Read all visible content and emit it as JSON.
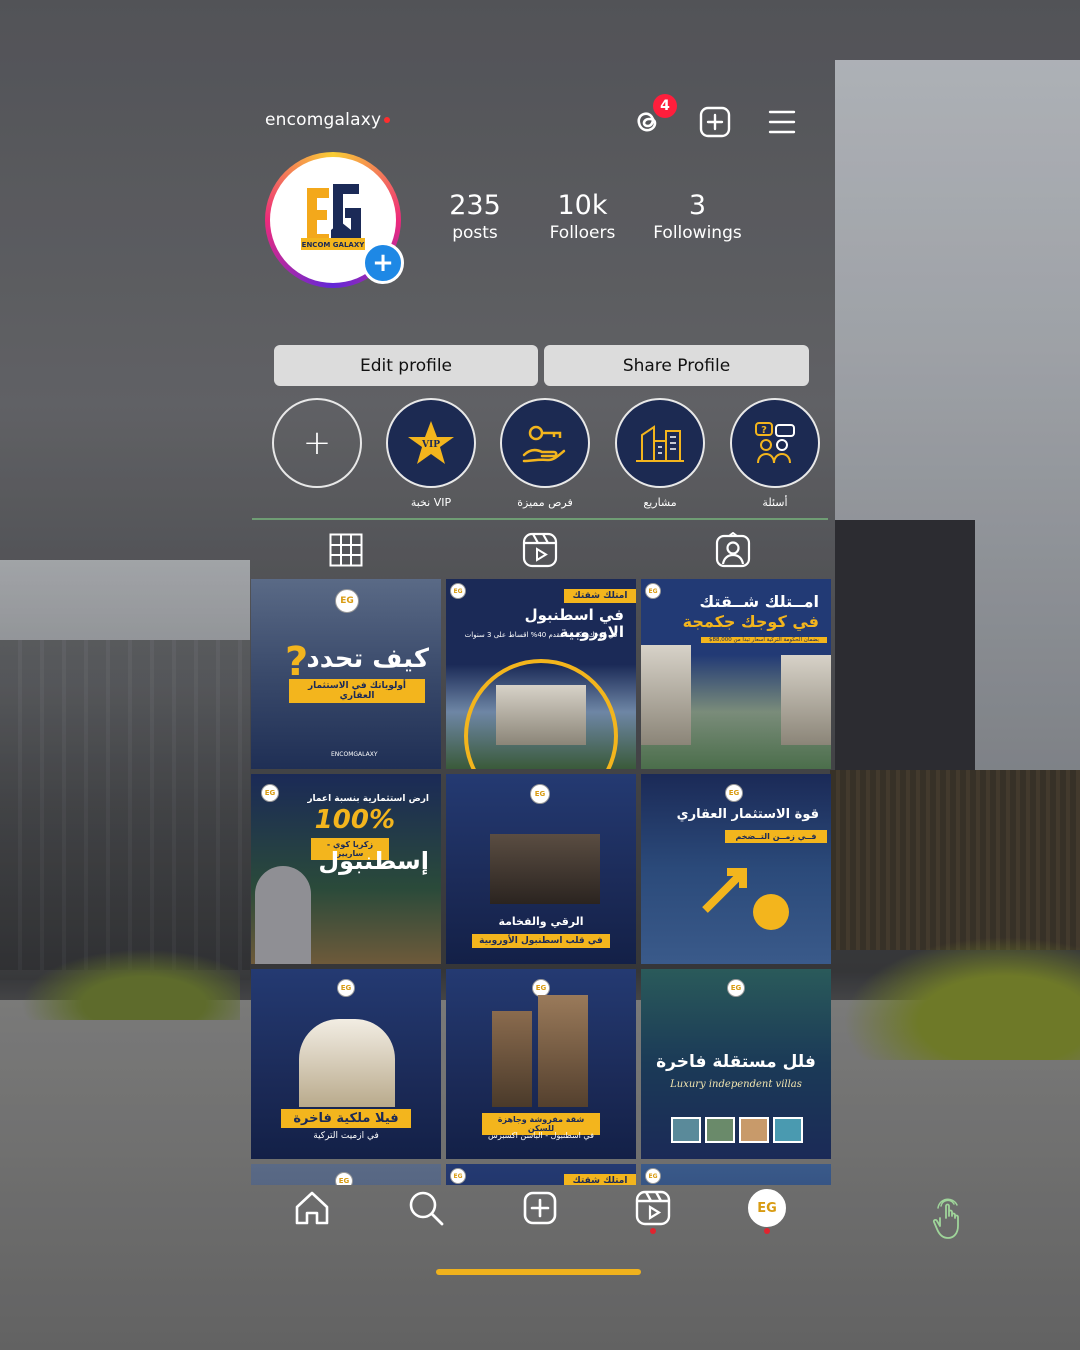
{
  "header": {
    "username": "encomgalaxy",
    "notification_count": "4"
  },
  "avatar": {
    "logo_text": "EG",
    "brand": "ENCOM GALAXY"
  },
  "stats": [
    {
      "value": "235",
      "label": "posts"
    },
    {
      "value": "10k",
      "label": "Folloers"
    },
    {
      "value": "3",
      "label": "Followings"
    }
  ],
  "buttons": {
    "edit": "Edit profile",
    "share": "Share Profile"
  },
  "highlights": [
    {
      "label": "",
      "icon": "plus-icon"
    },
    {
      "label": "نخبة VIP",
      "icon": "vip-star-icon"
    },
    {
      "label": "فرص مميزة",
      "icon": "key-hand-icon"
    },
    {
      "label": "مشاريع",
      "icon": "building-plan-icon"
    },
    {
      "label": "أسئلة",
      "icon": "people-question-icon"
    }
  ],
  "tabs": [
    "grid-icon",
    "reels-icon",
    "tagged-icon"
  ],
  "posts": [
    {
      "title": "كيف تحدد",
      "band": "أولوياتك في الاستثمار العقاري",
      "brand": "ENCOMGALAXY"
    },
    {
      "top_band": "امتلك شقتك",
      "title": "في اسطنبول الاوروبية",
      "small": "في كوجك جكمجة  مقدم 40%  اقساط على 3 سنوات"
    },
    {
      "title": "امــتلك شــقتك",
      "title2": "في كوجك جكمجة",
      "small": "بضمان الحكومة التركية  أسعار تبدأ من 88,000$"
    },
    {
      "title": "ارض استثمارية بنسبة اعمار",
      "big": "100%",
      "band": "زكريا كوي - سارييز",
      "city": "إسطنبول"
    },
    {
      "title": "الرقي والفخامة",
      "band": "في قلب اسطنبول الأوروبية"
    },
    {
      "title": "قوة الاستثمار العقاري",
      "band": "فــي زمــن التــضخم"
    },
    {
      "band": "فيلا ملكية فاخرة",
      "sub": "في ازميت التركية"
    },
    {
      "band": "شقة مفروشة وجاهزة للسكن",
      "sub": "في اسطنبول - الباسن اكسبرس"
    },
    {
      "title": "فلل مستقلة فاخرة",
      "sub": "Luxury independent villas"
    },
    {
      "top_band": "امتلك شقتك"
    }
  ],
  "bottom_nav": [
    "home-icon",
    "search-icon",
    "add-icon",
    "reels-icon",
    "profile-avatar"
  ]
}
